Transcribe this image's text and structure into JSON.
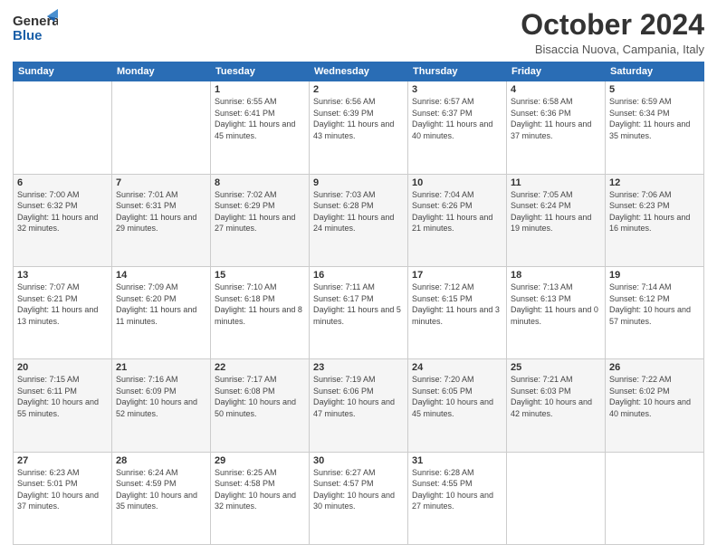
{
  "header": {
    "logo_general": "General",
    "logo_blue": "Blue",
    "month_title": "October 2024",
    "location": "Bisaccia Nuova, Campania, Italy"
  },
  "weekdays": [
    "Sunday",
    "Monday",
    "Tuesday",
    "Wednesday",
    "Thursday",
    "Friday",
    "Saturday"
  ],
  "weeks": [
    [
      {
        "day": "",
        "sunrise": "",
        "sunset": "",
        "daylight": ""
      },
      {
        "day": "",
        "sunrise": "",
        "sunset": "",
        "daylight": ""
      },
      {
        "day": "1",
        "sunrise": "Sunrise: 6:55 AM",
        "sunset": "Sunset: 6:41 PM",
        "daylight": "Daylight: 11 hours and 45 minutes."
      },
      {
        "day": "2",
        "sunrise": "Sunrise: 6:56 AM",
        "sunset": "Sunset: 6:39 PM",
        "daylight": "Daylight: 11 hours and 43 minutes."
      },
      {
        "day": "3",
        "sunrise": "Sunrise: 6:57 AM",
        "sunset": "Sunset: 6:37 PM",
        "daylight": "Daylight: 11 hours and 40 minutes."
      },
      {
        "day": "4",
        "sunrise": "Sunrise: 6:58 AM",
        "sunset": "Sunset: 6:36 PM",
        "daylight": "Daylight: 11 hours and 37 minutes."
      },
      {
        "day": "5",
        "sunrise": "Sunrise: 6:59 AM",
        "sunset": "Sunset: 6:34 PM",
        "daylight": "Daylight: 11 hours and 35 minutes."
      }
    ],
    [
      {
        "day": "6",
        "sunrise": "Sunrise: 7:00 AM",
        "sunset": "Sunset: 6:32 PM",
        "daylight": "Daylight: 11 hours and 32 minutes."
      },
      {
        "day": "7",
        "sunrise": "Sunrise: 7:01 AM",
        "sunset": "Sunset: 6:31 PM",
        "daylight": "Daylight: 11 hours and 29 minutes."
      },
      {
        "day": "8",
        "sunrise": "Sunrise: 7:02 AM",
        "sunset": "Sunset: 6:29 PM",
        "daylight": "Daylight: 11 hours and 27 minutes."
      },
      {
        "day": "9",
        "sunrise": "Sunrise: 7:03 AM",
        "sunset": "Sunset: 6:28 PM",
        "daylight": "Daylight: 11 hours and 24 minutes."
      },
      {
        "day": "10",
        "sunrise": "Sunrise: 7:04 AM",
        "sunset": "Sunset: 6:26 PM",
        "daylight": "Daylight: 11 hours and 21 minutes."
      },
      {
        "day": "11",
        "sunrise": "Sunrise: 7:05 AM",
        "sunset": "Sunset: 6:24 PM",
        "daylight": "Daylight: 11 hours and 19 minutes."
      },
      {
        "day": "12",
        "sunrise": "Sunrise: 7:06 AM",
        "sunset": "Sunset: 6:23 PM",
        "daylight": "Daylight: 11 hours and 16 minutes."
      }
    ],
    [
      {
        "day": "13",
        "sunrise": "Sunrise: 7:07 AM",
        "sunset": "Sunset: 6:21 PM",
        "daylight": "Daylight: 11 hours and 13 minutes."
      },
      {
        "day": "14",
        "sunrise": "Sunrise: 7:09 AM",
        "sunset": "Sunset: 6:20 PM",
        "daylight": "Daylight: 11 hours and 11 minutes."
      },
      {
        "day": "15",
        "sunrise": "Sunrise: 7:10 AM",
        "sunset": "Sunset: 6:18 PM",
        "daylight": "Daylight: 11 hours and 8 minutes."
      },
      {
        "day": "16",
        "sunrise": "Sunrise: 7:11 AM",
        "sunset": "Sunset: 6:17 PM",
        "daylight": "Daylight: 11 hours and 5 minutes."
      },
      {
        "day": "17",
        "sunrise": "Sunrise: 7:12 AM",
        "sunset": "Sunset: 6:15 PM",
        "daylight": "Daylight: 11 hours and 3 minutes."
      },
      {
        "day": "18",
        "sunrise": "Sunrise: 7:13 AM",
        "sunset": "Sunset: 6:13 PM",
        "daylight": "Daylight: 11 hours and 0 minutes."
      },
      {
        "day": "19",
        "sunrise": "Sunrise: 7:14 AM",
        "sunset": "Sunset: 6:12 PM",
        "daylight": "Daylight: 10 hours and 57 minutes."
      }
    ],
    [
      {
        "day": "20",
        "sunrise": "Sunrise: 7:15 AM",
        "sunset": "Sunset: 6:11 PM",
        "daylight": "Daylight: 10 hours and 55 minutes."
      },
      {
        "day": "21",
        "sunrise": "Sunrise: 7:16 AM",
        "sunset": "Sunset: 6:09 PM",
        "daylight": "Daylight: 10 hours and 52 minutes."
      },
      {
        "day": "22",
        "sunrise": "Sunrise: 7:17 AM",
        "sunset": "Sunset: 6:08 PM",
        "daylight": "Daylight: 10 hours and 50 minutes."
      },
      {
        "day": "23",
        "sunrise": "Sunrise: 7:19 AM",
        "sunset": "Sunset: 6:06 PM",
        "daylight": "Daylight: 10 hours and 47 minutes."
      },
      {
        "day": "24",
        "sunrise": "Sunrise: 7:20 AM",
        "sunset": "Sunset: 6:05 PM",
        "daylight": "Daylight: 10 hours and 45 minutes."
      },
      {
        "day": "25",
        "sunrise": "Sunrise: 7:21 AM",
        "sunset": "Sunset: 6:03 PM",
        "daylight": "Daylight: 10 hours and 42 minutes."
      },
      {
        "day": "26",
        "sunrise": "Sunrise: 7:22 AM",
        "sunset": "Sunset: 6:02 PM",
        "daylight": "Daylight: 10 hours and 40 minutes."
      }
    ],
    [
      {
        "day": "27",
        "sunrise": "Sunrise: 6:23 AM",
        "sunset": "Sunset: 5:01 PM",
        "daylight": "Daylight: 10 hours and 37 minutes."
      },
      {
        "day": "28",
        "sunrise": "Sunrise: 6:24 AM",
        "sunset": "Sunset: 4:59 PM",
        "daylight": "Daylight: 10 hours and 35 minutes."
      },
      {
        "day": "29",
        "sunrise": "Sunrise: 6:25 AM",
        "sunset": "Sunset: 4:58 PM",
        "daylight": "Daylight: 10 hours and 32 minutes."
      },
      {
        "day": "30",
        "sunrise": "Sunrise: 6:27 AM",
        "sunset": "Sunset: 4:57 PM",
        "daylight": "Daylight: 10 hours and 30 minutes."
      },
      {
        "day": "31",
        "sunrise": "Sunrise: 6:28 AM",
        "sunset": "Sunset: 4:55 PM",
        "daylight": "Daylight: 10 hours and 27 minutes."
      },
      {
        "day": "",
        "sunrise": "",
        "sunset": "",
        "daylight": ""
      },
      {
        "day": "",
        "sunrise": "",
        "sunset": "",
        "daylight": ""
      }
    ]
  ]
}
